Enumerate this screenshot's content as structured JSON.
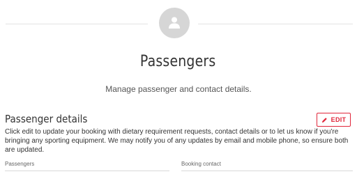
{
  "header": {
    "avatar_icon": "user-icon",
    "title": "Passengers",
    "subtitle": "Manage passenger and contact details."
  },
  "passenger_details": {
    "title": "Passenger details",
    "edit_label": "EDIT",
    "edit_icon": "pencil-icon",
    "description": "Click edit to update your booking with dietary requirement requests, contact details or to let us know if you're bringing any sporting equipment. We may notify you of any updates by email and mobile phone, so ensure both are updated."
  },
  "fields": {
    "passengers_label": "Passengers",
    "booking_contact_label": "Booking contact"
  },
  "colors": {
    "accent": "#e0263a",
    "avatar_bg": "#d6d6d6",
    "divider": "#e3e3e3"
  }
}
